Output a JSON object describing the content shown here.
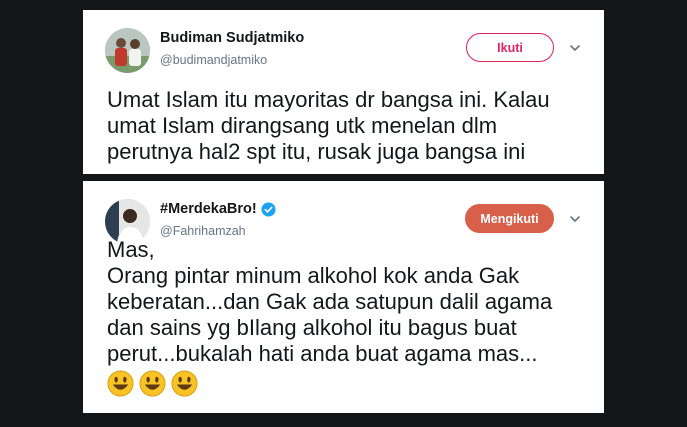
{
  "tweets": [
    {
      "name": "Budiman Sudjatmiko",
      "handle": "@budimandjatmiko",
      "verified": false,
      "button_label": "Ikuti",
      "lines": [
        "Umat Islam itu mayoritas dr bangsa ini. Kalau",
        "umat Islam dirangsang utk menelan dlm",
        "perutnya hal2 spt itu, rusak juga bangsa ini"
      ]
    },
    {
      "name": "#MerdekaBro!",
      "handle": "@Fahrihamzah",
      "verified": true,
      "button_label": "Mengikuti",
      "lines": [
        "Mas,",
        "Orang pintar minum alkohol kok anda Gak",
        "keberatan...dan Gak ada satupun dalil agama",
        "dan sains yg bIlang alkohol itu bagus buat",
        "perut...bukalah hati anda buat agama mas..."
      ],
      "emojis": [
        "smiley-icon",
        "smiley-icon",
        "smiley-icon"
      ]
    }
  ],
  "colors": {
    "follow_outline": "#e0245e",
    "following_fill": "#d8604a",
    "verified": "#1da1f2",
    "backdrop": "#14171a"
  }
}
